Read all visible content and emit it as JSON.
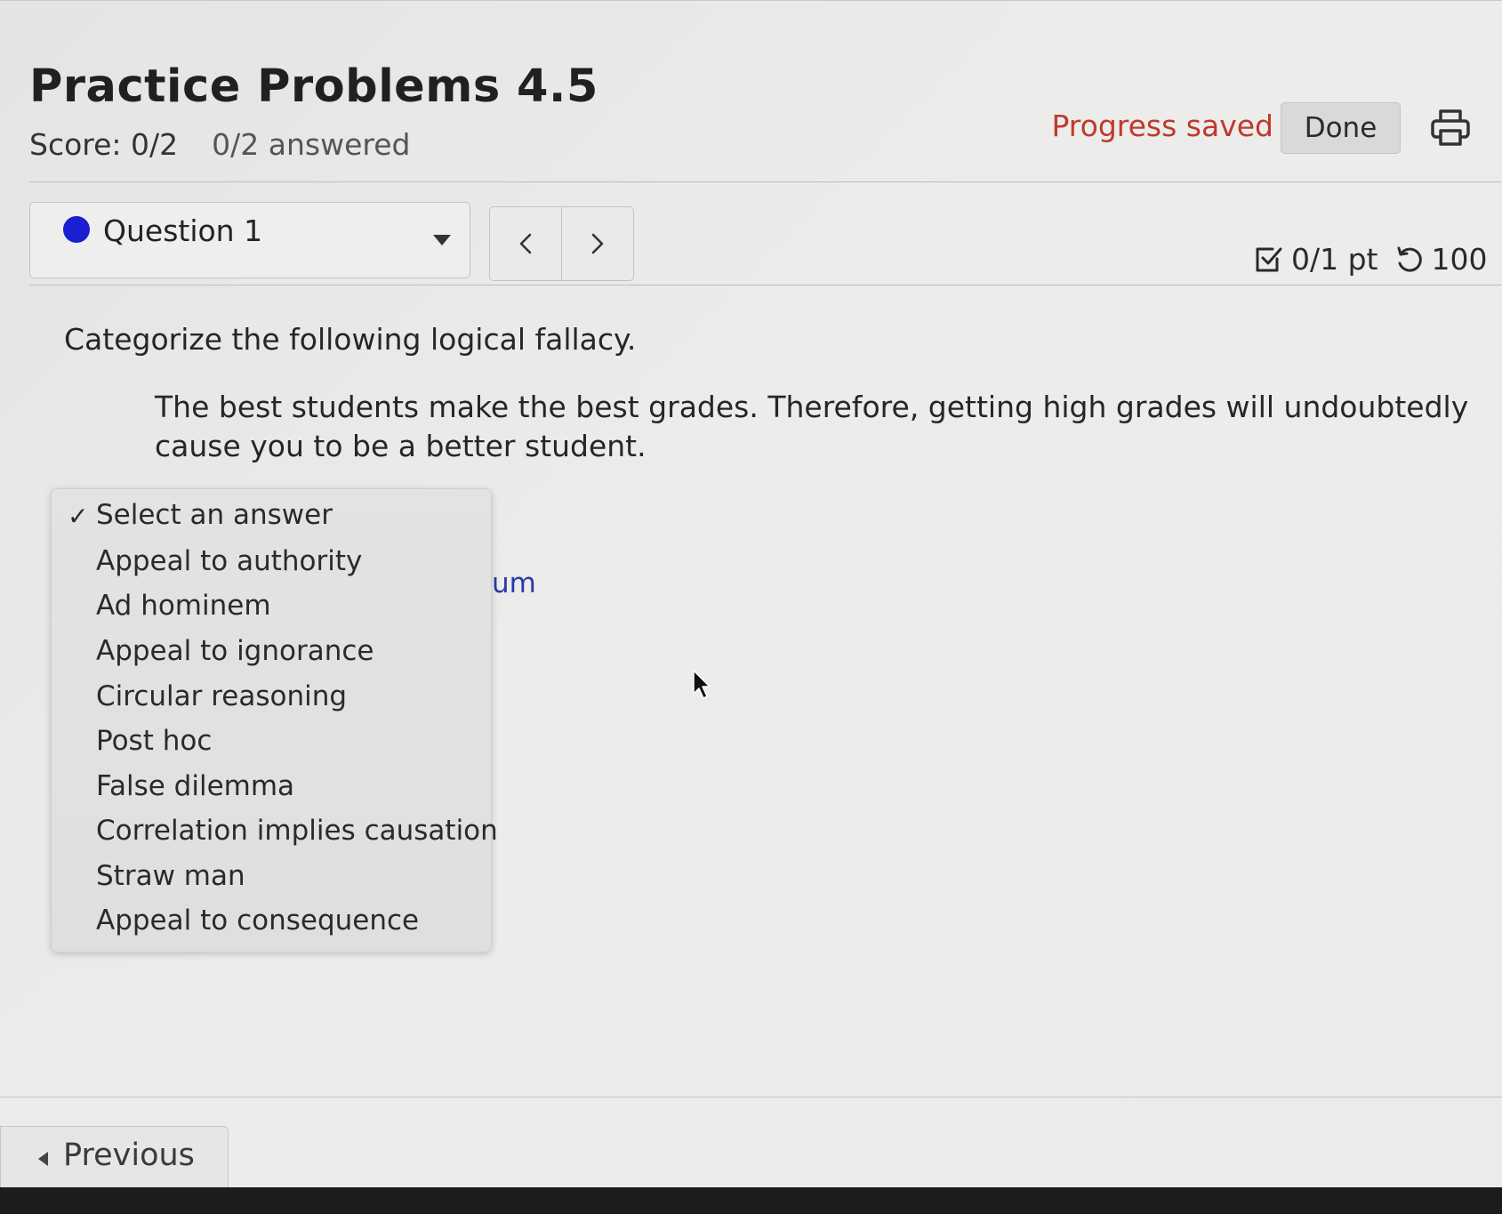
{
  "header": {
    "title": "Practice Problems 4.5",
    "score": "Score: 0/2",
    "answered": "0/2 answered",
    "progress_status": "Progress saved",
    "done_label": "Done"
  },
  "question_nav": {
    "selected_question": "Question 1",
    "status_dot_color": "#1a1fd1",
    "points": "0/1 pt",
    "attempts": "100"
  },
  "question": {
    "prompt": "Categorize the following logical fallacy.",
    "statement": "The best students make the best grades. Therefore, getting high grades will undoubtedly cause you to be a better student.",
    "partially_hidden_text": "um"
  },
  "answer_dropdown": {
    "selected_index": 0,
    "check_mark": "✓",
    "options": [
      "Select an answer",
      "Appeal to authority",
      "Ad hominem",
      "Appeal to ignorance",
      "Circular reasoning",
      "Post hoc",
      "False dilemma",
      "Correlation implies causation",
      "Straw man",
      "Appeal to consequence"
    ]
  },
  "footer": {
    "previous_label": "Previous"
  },
  "colors": {
    "progress_saved": "#c0392b",
    "question_dot": "#1a1fd1",
    "link_text": "#2a3aa8"
  },
  "icons": {
    "print": "printer-icon",
    "prev_question": "chevron-left-icon",
    "next_question": "chevron-right-icon",
    "points": "checkbox-icon",
    "retry": "retry-icon",
    "question_menu": "caret-down-icon",
    "cursor": "mouse-pointer-icon",
    "previous": "caret-left-icon"
  }
}
